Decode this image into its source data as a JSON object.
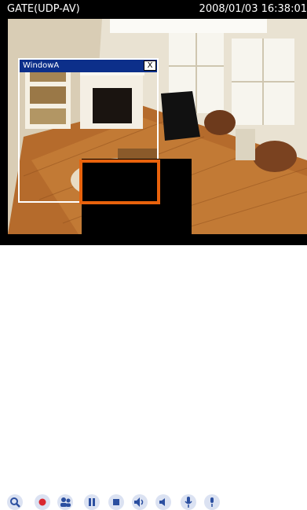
{
  "title_bar": {
    "camera_name": "GATE(UDP-AV)",
    "datetime": "2008/01/03 16:38:01"
  },
  "window_a": {
    "title": "WindowA",
    "close_label": "X"
  },
  "colors": {
    "title_bar_bg": "#000000",
    "window_title_bg": "#0c2f8a",
    "highlight_border": "#e8620c",
    "toolbar_icon": "#2b4fa0",
    "record_icon": "#d9262e"
  },
  "toolbar": {
    "buttons": [
      {
        "icon": "zoom-icon"
      },
      {
        "icon": "record-icon"
      },
      {
        "icon": "users-icon"
      },
      {
        "icon": "pause-icon"
      },
      {
        "icon": "stop-icon"
      },
      {
        "icon": "speaker-icon"
      },
      {
        "icon": "volume-icon"
      },
      {
        "icon": "microphone-icon"
      },
      {
        "icon": "microphone-mute-icon"
      }
    ]
  }
}
